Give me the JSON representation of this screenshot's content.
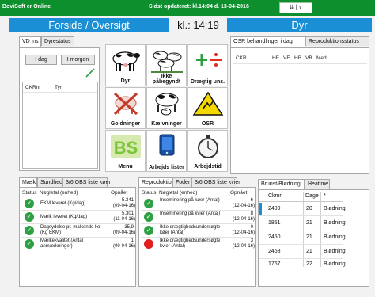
{
  "topbar": {
    "app_name": "BoviSoft er Online",
    "updated": "Sidst opdateret: kl.14:04 d. 13-04-2016",
    "window_control": "⇊ | ∨"
  },
  "header": {
    "left_title": "Forside / Oversigt",
    "clock": "kl.: 14:19",
    "right_title": "Dyr"
  },
  "vd_panel": {
    "tabs": [
      "VD ins",
      "Dyrestatus"
    ],
    "btn_today": "I dag",
    "btn_tomorrow": "I morgen",
    "col_ckr": "CKRnr",
    "col_tyr": "Tyr"
  },
  "tiles": [
    {
      "label": "Dyr",
      "icon": "cow-icon"
    },
    {
      "label": "Ikke påbegyndt",
      "icon": "herd-icon"
    },
    {
      "label": "Drægtig uns.",
      "icon": "plus-divide-icon"
    },
    {
      "label": "Goldninger",
      "icon": "cow-crossed-icon"
    },
    {
      "label": "Kælvninger",
      "icon": "calving-icon"
    },
    {
      "label": "OSR",
      "icon": "warning-icon"
    },
    {
      "label": "Menu",
      "icon": "bs-logo-icon"
    },
    {
      "label": "Arbejds lister",
      "icon": "tablet-icon"
    },
    {
      "label": "Arbejdstid",
      "icon": "stopwatch-icon"
    }
  ],
  "osr_panel": {
    "tabs": [
      "OSR behandlinger i dag",
      "Reproduktionsstatus"
    ],
    "columns": [
      "CKR",
      "HF",
      "VF",
      "HB",
      "VB",
      "Med."
    ]
  },
  "mid_left": {
    "tabs": [
      "Mælk",
      "Sundhed",
      "3/6 OBS liste køer"
    ],
    "columns": [
      "Status",
      "Nøgletal (enhed)",
      "Opnået"
    ],
    "rows": [
      {
        "status": "ok",
        "name": "EKM leveret (Kg/dag)",
        "value": "5.341",
        "date": "(09-04-16)"
      },
      {
        "status": "ok",
        "name": "Mælk leveret (Kg/dag)",
        "value": "5.301",
        "date": "(11-04-16)"
      },
      {
        "status": "ok",
        "name": "Dagsydelse pr. malkende ko (Kg EKM)",
        "value": "35,9",
        "date": "(09-04-16)"
      },
      {
        "status": "ok",
        "name": "Mælkekvalitet (Antal anmærkninger)",
        "value": "1",
        "date": "(09-04-16)"
      }
    ]
  },
  "mid_center": {
    "tabs": [
      "Reproduktion",
      "Foder",
      "3/6 OBS liste kvier"
    ],
    "columns": [
      "Status",
      "Nøgletal (enhed)",
      "Opnået"
    ],
    "rows": [
      {
        "status": "ok",
        "name": "Inseminering på køer (Antal)",
        "value": "6",
        "date": "(12-04-16)"
      },
      {
        "status": "ok",
        "name": "Inseminering på kvier (Antal)",
        "value": "8",
        "date": "(12-04-16)"
      },
      {
        "status": "ok",
        "name": "Ikke drægtighedsundersøgte køer (Antal)",
        "value": "0",
        "date": "(12-04-16)"
      },
      {
        "status": "bad",
        "name": "Ikke drægtighedsundersøgte kvier (Antal)",
        "value": "3",
        "date": "(12-04-16)"
      }
    ]
  },
  "brunst_panel": {
    "tabs": [
      "Brunst/Blødning",
      "Heatime"
    ],
    "columns": [
      "Ckmr",
      "Dage",
      "*"
    ],
    "rows": [
      {
        "ckr": "2499",
        "dage": "20",
        "status": "Blødning"
      },
      {
        "ckr": "1851",
        "dage": "21",
        "status": "Blødning"
      },
      {
        "ckr": "2450",
        "dage": "21",
        "status": "Blødning"
      },
      {
        "ckr": "2458",
        "dage": "21",
        "status": "Blødning"
      },
      {
        "ckr": "1767",
        "dage": "22",
        "status": "Blødning"
      }
    ]
  },
  "colors": {
    "topbar": "#0e8f2e",
    "accent_blue": "#1a8fd6",
    "status_ok": "#2ea043",
    "status_bad": "#e02020"
  }
}
